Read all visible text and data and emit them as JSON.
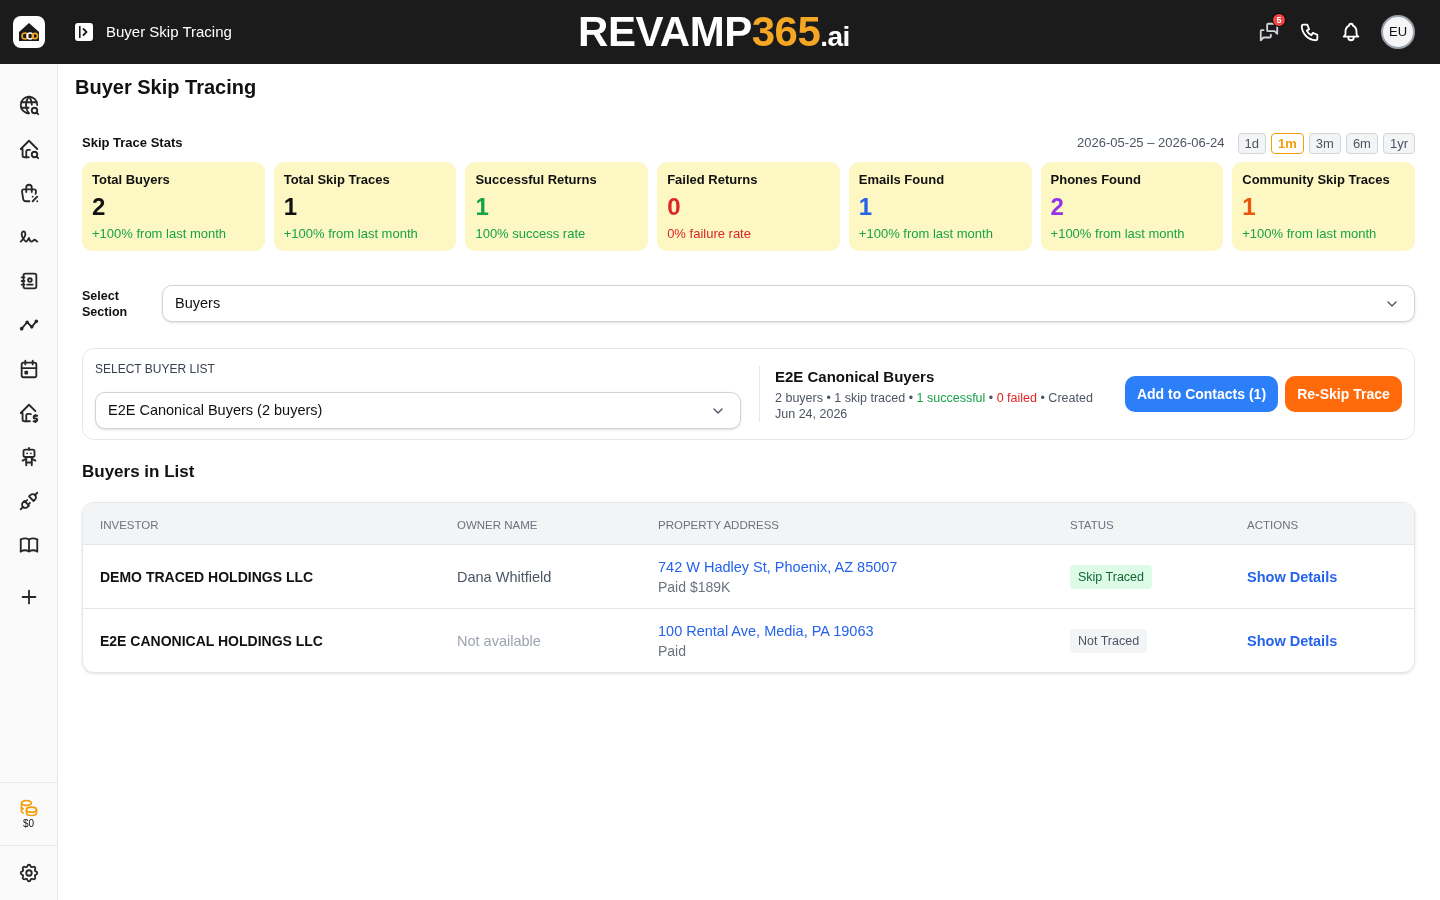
{
  "app_bar": {
    "page_label": "Buyer Skip Tracing",
    "logo": {
      "word": "REVAMP",
      "number": "365",
      "suffix": ".ai"
    },
    "messages_badge": "5",
    "avatar": "EU"
  },
  "sidebar": {
    "balance": "$0"
  },
  "page_title": "Buyer Skip Tracing",
  "stats": {
    "title": "Skip Trace Stats",
    "date_range": "2026-05-25 – 2026-06-24",
    "periods": [
      {
        "label": "1d",
        "selected": false
      },
      {
        "label": "1m",
        "selected": true
      },
      {
        "label": "3m",
        "selected": false
      },
      {
        "label": "6m",
        "selected": false
      },
      {
        "label": "1yr",
        "selected": false
      }
    ],
    "cards": [
      {
        "label": "Total Buyers",
        "value": "2",
        "color": "#111111",
        "note": "+100% from last month",
        "negative": false
      },
      {
        "label": "Total Skip Traces",
        "value": "1",
        "color": "#111111",
        "note": "+100% from last month",
        "negative": false
      },
      {
        "label": "Successful Returns",
        "value": "1",
        "color": "#16a34a",
        "note": "100% success rate",
        "negative": false
      },
      {
        "label": "Failed Returns",
        "value": "0",
        "color": "#dc2626",
        "note": "0% failure rate",
        "negative": true
      },
      {
        "label": "Emails Found",
        "value": "1",
        "color": "#2563eb",
        "note": "+100% from last month",
        "negative": false
      },
      {
        "label": "Phones Found",
        "value": "2",
        "color": "#9333ea",
        "note": "+100% from last month",
        "negative": false
      },
      {
        "label": "Community Skip Traces",
        "value": "1",
        "color": "#ea580c",
        "note": "+100% from last month",
        "negative": false
      }
    ]
  },
  "section_select": {
    "label": "Select Section",
    "value": "Buyers"
  },
  "buyer_list": {
    "label": "SELECT BUYER LIST",
    "value": "E2E Canonical Buyers (2 buyers)",
    "name": "E2E Canonical Buyers",
    "summary": [
      {
        "kind": "plain",
        "text": "2 buyers"
      },
      {
        "kind": "plain",
        "text": "•"
      },
      {
        "kind": "plain",
        "text": "1 skip traced"
      },
      {
        "kind": "plain",
        "text": "•"
      },
      {
        "kind": "success",
        "text": "1 successful"
      },
      {
        "kind": "plain",
        "text": "•"
      },
      {
        "kind": "failed",
        "text": "0 failed"
      },
      {
        "kind": "plain",
        "text": "•"
      },
      {
        "kind": "plain",
        "text": "Created Jun 24, 2026"
      }
    ],
    "buttons": [
      {
        "kind": "primary",
        "label": "Add to Contacts (1)"
      },
      {
        "kind": "accent",
        "label": "Re-Skip Trace"
      }
    ]
  },
  "table": {
    "title": "Buyers in List",
    "columns": [
      "INVESTOR",
      "OWNER NAME",
      "PROPERTY ADDRESS",
      "STATUS",
      "ACTIONS"
    ],
    "rows": [
      {
        "investor": "DEMO TRACED HOLDINGS LLC",
        "owner": "Dana Whitfield",
        "owner_available": true,
        "address": "742 W Hadley St, Phoenix, AZ 85007",
        "price": "Paid $189K",
        "status": "Skip Traced",
        "traced": true,
        "action": "Show Details"
      },
      {
        "investor": "E2E CANONICAL HOLDINGS LLC",
        "owner": "Not available",
        "owner_available": false,
        "address": "100 Rental Ave, Media, PA 19063",
        "price": "Paid",
        "status": "Not Traced",
        "traced": false,
        "action": "Show Details"
      }
    ]
  }
}
